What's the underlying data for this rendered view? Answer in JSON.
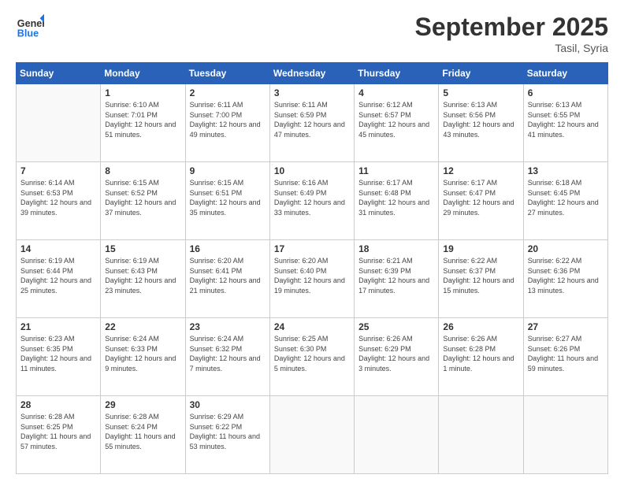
{
  "header": {
    "logo_line1": "General",
    "logo_line2": "Blue",
    "month": "September 2025",
    "location": "Tasil, Syria"
  },
  "columns": [
    "Sunday",
    "Monday",
    "Tuesday",
    "Wednesday",
    "Thursday",
    "Friday",
    "Saturday"
  ],
  "weeks": [
    [
      {
        "day": "",
        "sunrise": "",
        "sunset": "",
        "daylight": ""
      },
      {
        "day": "1",
        "sunrise": "Sunrise: 6:10 AM",
        "sunset": "Sunset: 7:01 PM",
        "daylight": "Daylight: 12 hours and 51 minutes."
      },
      {
        "day": "2",
        "sunrise": "Sunrise: 6:11 AM",
        "sunset": "Sunset: 7:00 PM",
        "daylight": "Daylight: 12 hours and 49 minutes."
      },
      {
        "day": "3",
        "sunrise": "Sunrise: 6:11 AM",
        "sunset": "Sunset: 6:59 PM",
        "daylight": "Daylight: 12 hours and 47 minutes."
      },
      {
        "day": "4",
        "sunrise": "Sunrise: 6:12 AM",
        "sunset": "Sunset: 6:57 PM",
        "daylight": "Daylight: 12 hours and 45 minutes."
      },
      {
        "day": "5",
        "sunrise": "Sunrise: 6:13 AM",
        "sunset": "Sunset: 6:56 PM",
        "daylight": "Daylight: 12 hours and 43 minutes."
      },
      {
        "day": "6",
        "sunrise": "Sunrise: 6:13 AM",
        "sunset": "Sunset: 6:55 PM",
        "daylight": "Daylight: 12 hours and 41 minutes."
      }
    ],
    [
      {
        "day": "7",
        "sunrise": "Sunrise: 6:14 AM",
        "sunset": "Sunset: 6:53 PM",
        "daylight": "Daylight: 12 hours and 39 minutes."
      },
      {
        "day": "8",
        "sunrise": "Sunrise: 6:15 AM",
        "sunset": "Sunset: 6:52 PM",
        "daylight": "Daylight: 12 hours and 37 minutes."
      },
      {
        "day": "9",
        "sunrise": "Sunrise: 6:15 AM",
        "sunset": "Sunset: 6:51 PM",
        "daylight": "Daylight: 12 hours and 35 minutes."
      },
      {
        "day": "10",
        "sunrise": "Sunrise: 6:16 AM",
        "sunset": "Sunset: 6:49 PM",
        "daylight": "Daylight: 12 hours and 33 minutes."
      },
      {
        "day": "11",
        "sunrise": "Sunrise: 6:17 AM",
        "sunset": "Sunset: 6:48 PM",
        "daylight": "Daylight: 12 hours and 31 minutes."
      },
      {
        "day": "12",
        "sunrise": "Sunrise: 6:17 AM",
        "sunset": "Sunset: 6:47 PM",
        "daylight": "Daylight: 12 hours and 29 minutes."
      },
      {
        "day": "13",
        "sunrise": "Sunrise: 6:18 AM",
        "sunset": "Sunset: 6:45 PM",
        "daylight": "Daylight: 12 hours and 27 minutes."
      }
    ],
    [
      {
        "day": "14",
        "sunrise": "Sunrise: 6:19 AM",
        "sunset": "Sunset: 6:44 PM",
        "daylight": "Daylight: 12 hours and 25 minutes."
      },
      {
        "day": "15",
        "sunrise": "Sunrise: 6:19 AM",
        "sunset": "Sunset: 6:43 PM",
        "daylight": "Daylight: 12 hours and 23 minutes."
      },
      {
        "day": "16",
        "sunrise": "Sunrise: 6:20 AM",
        "sunset": "Sunset: 6:41 PM",
        "daylight": "Daylight: 12 hours and 21 minutes."
      },
      {
        "day": "17",
        "sunrise": "Sunrise: 6:20 AM",
        "sunset": "Sunset: 6:40 PM",
        "daylight": "Daylight: 12 hours and 19 minutes."
      },
      {
        "day": "18",
        "sunrise": "Sunrise: 6:21 AM",
        "sunset": "Sunset: 6:39 PM",
        "daylight": "Daylight: 12 hours and 17 minutes."
      },
      {
        "day": "19",
        "sunrise": "Sunrise: 6:22 AM",
        "sunset": "Sunset: 6:37 PM",
        "daylight": "Daylight: 12 hours and 15 minutes."
      },
      {
        "day": "20",
        "sunrise": "Sunrise: 6:22 AM",
        "sunset": "Sunset: 6:36 PM",
        "daylight": "Daylight: 12 hours and 13 minutes."
      }
    ],
    [
      {
        "day": "21",
        "sunrise": "Sunrise: 6:23 AM",
        "sunset": "Sunset: 6:35 PM",
        "daylight": "Daylight: 12 hours and 11 minutes."
      },
      {
        "day": "22",
        "sunrise": "Sunrise: 6:24 AM",
        "sunset": "Sunset: 6:33 PM",
        "daylight": "Daylight: 12 hours and 9 minutes."
      },
      {
        "day": "23",
        "sunrise": "Sunrise: 6:24 AM",
        "sunset": "Sunset: 6:32 PM",
        "daylight": "Daylight: 12 hours and 7 minutes."
      },
      {
        "day": "24",
        "sunrise": "Sunrise: 6:25 AM",
        "sunset": "Sunset: 6:30 PM",
        "daylight": "Daylight: 12 hours and 5 minutes."
      },
      {
        "day": "25",
        "sunrise": "Sunrise: 6:26 AM",
        "sunset": "Sunset: 6:29 PM",
        "daylight": "Daylight: 12 hours and 3 minutes."
      },
      {
        "day": "26",
        "sunrise": "Sunrise: 6:26 AM",
        "sunset": "Sunset: 6:28 PM",
        "daylight": "Daylight: 12 hours and 1 minute."
      },
      {
        "day": "27",
        "sunrise": "Sunrise: 6:27 AM",
        "sunset": "Sunset: 6:26 PM",
        "daylight": "Daylight: 11 hours and 59 minutes."
      }
    ],
    [
      {
        "day": "28",
        "sunrise": "Sunrise: 6:28 AM",
        "sunset": "Sunset: 6:25 PM",
        "daylight": "Daylight: 11 hours and 57 minutes."
      },
      {
        "day": "29",
        "sunrise": "Sunrise: 6:28 AM",
        "sunset": "Sunset: 6:24 PM",
        "daylight": "Daylight: 11 hours and 55 minutes."
      },
      {
        "day": "30",
        "sunrise": "Sunrise: 6:29 AM",
        "sunset": "Sunset: 6:22 PM",
        "daylight": "Daylight: 11 hours and 53 minutes."
      },
      {
        "day": "",
        "sunrise": "",
        "sunset": "",
        "daylight": ""
      },
      {
        "day": "",
        "sunrise": "",
        "sunset": "",
        "daylight": ""
      },
      {
        "day": "",
        "sunrise": "",
        "sunset": "",
        "daylight": ""
      },
      {
        "day": "",
        "sunrise": "",
        "sunset": "",
        "daylight": ""
      }
    ]
  ]
}
